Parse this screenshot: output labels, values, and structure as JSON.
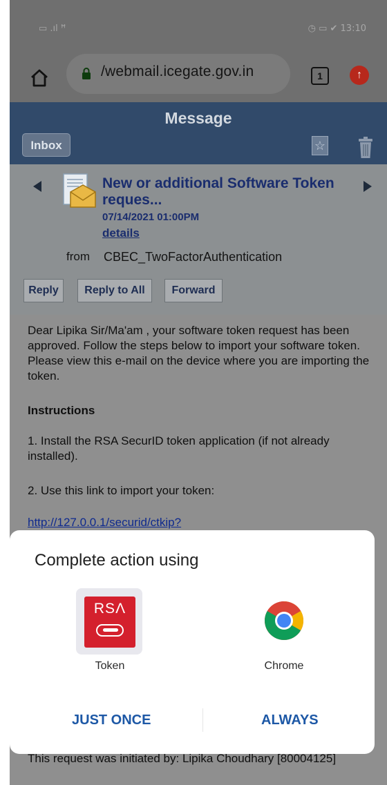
{
  "status_bar": {
    "left": "▭ .ıl ꟸ",
    "right": "◷ ▭ ✔ 13:10"
  },
  "browser": {
    "url": "/webmail.icegate.gov.in",
    "tab_count": "1"
  },
  "header": {
    "title": "Message",
    "inbox_label": "Inbox"
  },
  "message": {
    "subject": "New or additional Software Token reques...",
    "date": "07/14/2021 01:00PM",
    "details_link": "details",
    "from_label": "from",
    "from_value": "CBEC_TwoFactorAuthentication"
  },
  "actions": {
    "reply": "Reply",
    "reply_all": "Reply to All",
    "forward": "Forward"
  },
  "body": {
    "p1": "Dear Lipika Sir/Ma'am , your software token request has been approved. Follow the steps below to import your software token. Please view this e-mail on the device where you are importing the token.",
    "instructions_heading": "Instructions",
    "step1": "1. Install the RSA SecurID token application (if not already installed).",
    "step2": "2. Use this link to import your token:",
    "link": "http://127.0.0.1/securid/ctkip?",
    "footer": "This request was initiated by: Lipika Choudhary [80004125]"
  },
  "dialog": {
    "title": "Complete action using",
    "apps": [
      {
        "label": "Token",
        "icon_text": "RSΛ"
      },
      {
        "label": "Chrome"
      }
    ],
    "just_once": "JUST ONCE",
    "always": "ALWAYS"
  },
  "colors": {
    "header_bg": "#314a6a",
    "link_blue": "#1d58a6",
    "rsa_red": "#d4202d"
  }
}
